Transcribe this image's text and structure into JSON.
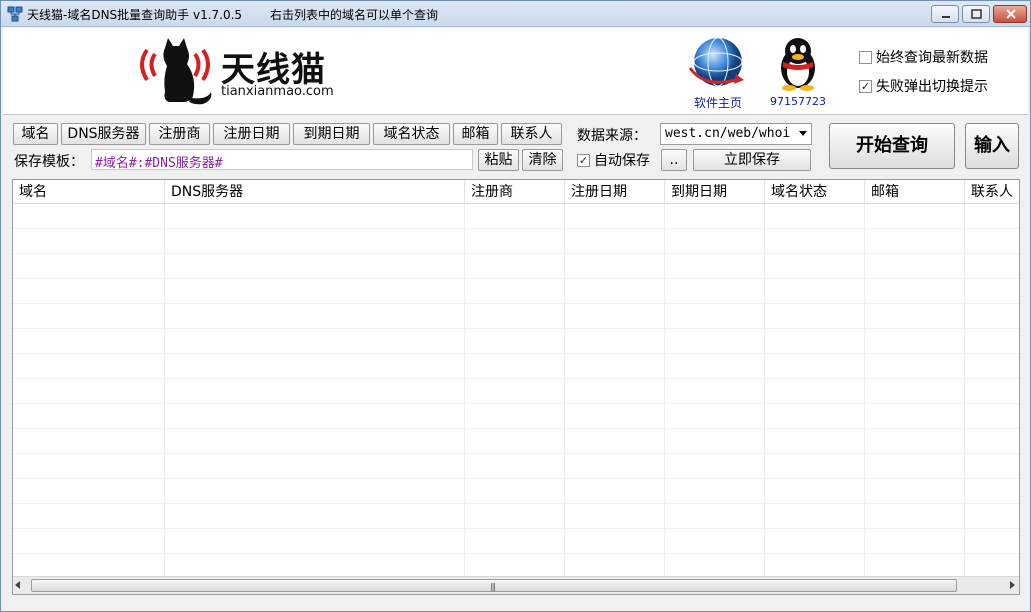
{
  "window": {
    "title": "天线猫-域名DNS批量查询助手 v1.7.0.5",
    "hint": "右击列表中的域名可以单个查询",
    "icons": {
      "app": "network-icon",
      "minimize": "minimize-icon",
      "maximize": "maximize-icon",
      "close": "close-icon"
    }
  },
  "banner": {
    "logo_text": "天线猫",
    "logo_domain": "tianxianmao.com",
    "home_label": "软件主页",
    "qq_label": "97157723",
    "option_latest": "始终查询最新数据",
    "option_fail_prompt": "失败弹出切换提示",
    "option_latest_checked": false,
    "option_fail_checked": true
  },
  "toolbar": {
    "field_buttons": [
      "域名",
      "DNS服务器",
      "注册商",
      "注册日期",
      "到期日期",
      "域名状态",
      "邮箱",
      "联系人"
    ],
    "template_label": "保存模板：",
    "template_value": "#域名#:#DNS服务器#",
    "paste": "粘贴",
    "clear": "清除",
    "source_label": "数据来源：",
    "source_value": "west.cn/web/whoi",
    "autosave_label": "自动保存",
    "autosave_checked": true,
    "dots": "..",
    "save_now": "立即保存",
    "start": "开始查询",
    "input": "输入"
  },
  "table": {
    "columns": [
      "域名",
      "DNS服务器",
      "注册商",
      "注册日期",
      "到期日期",
      "域名状态",
      "邮箱",
      "联系人"
    ],
    "rows": []
  },
  "colors": {
    "accent_red": "#d32121",
    "link_blue": "#0b1ea0",
    "template_text": "#8b1fa8"
  }
}
